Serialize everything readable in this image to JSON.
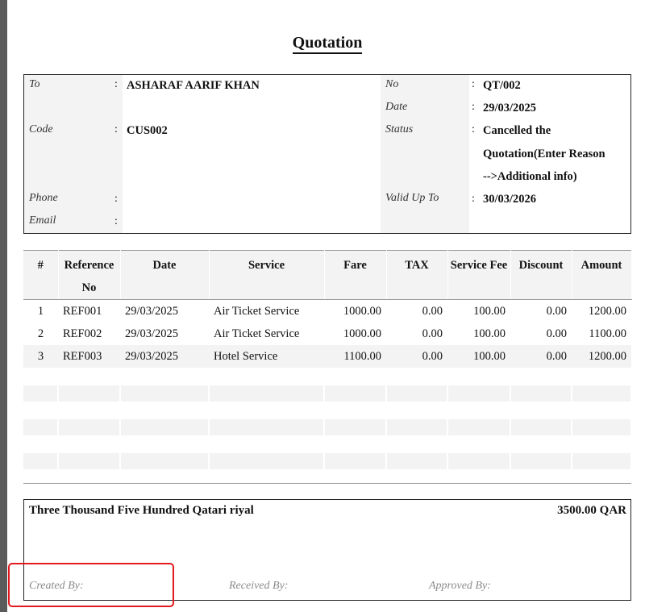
{
  "title": "Quotation",
  "customer": {
    "to_label": "To",
    "to_value": "ASHARAF AARIF KHAN",
    "code_label": "Code",
    "code_value": "CUS002",
    "phone_label": "Phone",
    "phone_value": "",
    "email_label": "Email",
    "email_value": ""
  },
  "quote_info": {
    "no_label": "No",
    "no_value": "QT/002",
    "date_label": "Date",
    "date_value": "29/03/2025",
    "status_label": "Status",
    "status_lines": [
      "Cancelled the",
      "Quotation(Enter Reason",
      "-->Additional info)"
    ],
    "valid_label": "Valid Up To",
    "valid_value": "30/03/2026"
  },
  "separator": ":",
  "table": {
    "headers": [
      "#",
      "Reference No",
      "Date",
      "Service",
      "Fare",
      "TAX",
      "Service Fee",
      "Discount",
      "Amount"
    ],
    "rows": [
      [
        "1",
        "REF001",
        "29/03/2025",
        "Air Ticket Service",
        "1000.00",
        "0.00",
        "100.00",
        "0.00",
        "1200.00"
      ],
      [
        "2",
        "REF002",
        "29/03/2025",
        "Air Ticket Service",
        "1000.00",
        "0.00",
        "100.00",
        "0.00",
        "1100.00"
      ],
      [
        "3",
        "REF003",
        "29/03/2025",
        "Hotel Service",
        "1100.00",
        "0.00",
        "100.00",
        "0.00",
        "1200.00"
      ]
    ]
  },
  "footer": {
    "amount_in_words": "Three Thousand Five Hundred Qatari riyal",
    "total": "3500.00 QAR",
    "created_by": "Created By:",
    "received_by": "Received By:",
    "approved_by": "Approved By:"
  },
  "colors": {
    "highlight": "#e3191d",
    "label_background": "#f3f3f3"
  }
}
